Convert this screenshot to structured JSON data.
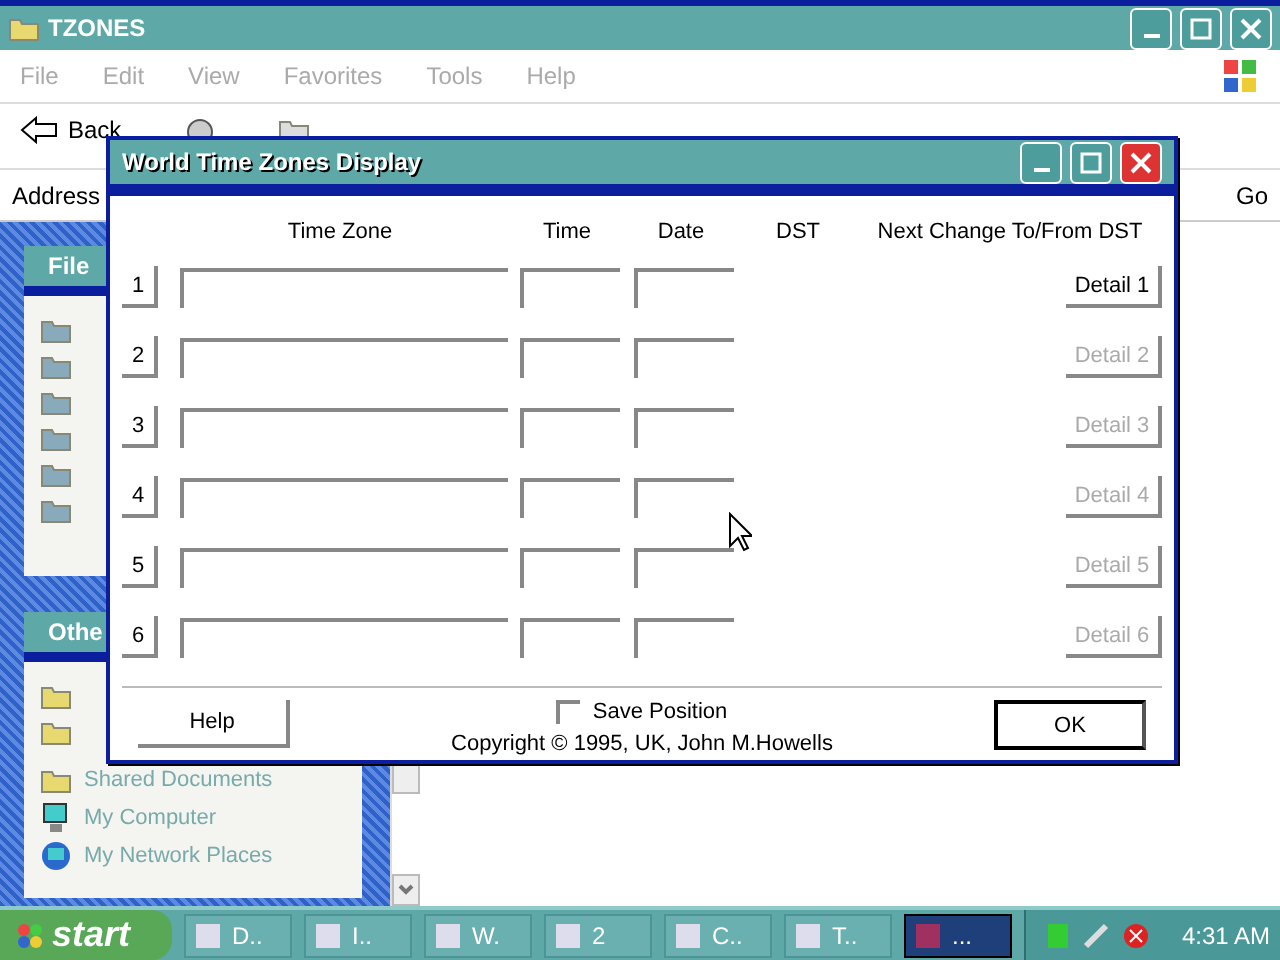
{
  "explorer": {
    "title": "TZONES",
    "menu": [
      "File",
      "Edit",
      "View",
      "Favorites",
      "Tools",
      "Help"
    ],
    "toolbar": [
      {
        "kind": "back",
        "label": "Back"
      },
      {
        "kind": "search"
      },
      {
        "kind": "folders"
      }
    ],
    "address_label": "Address",
    "go_label": "Go",
    "panels": [
      {
        "title": "File"
      },
      {
        "title": "Othe",
        "items": [
          "Shared Documents",
          "My Computer",
          "My Network Places"
        ]
      }
    ]
  },
  "dialog": {
    "title": "World Time Zones Display",
    "columns": [
      "Time Zone",
      "Time",
      "Date",
      "DST",
      "Next Change To/From DST"
    ],
    "rows": [
      {
        "number": "1",
        "detail": "Detail 1",
        "disabled": false
      },
      {
        "number": "2",
        "detail": "Detail 2",
        "disabled": true
      },
      {
        "number": "3",
        "detail": "Detail 3",
        "disabled": true
      },
      {
        "number": "4",
        "detail": "Detail 4",
        "disabled": true
      },
      {
        "number": "5",
        "detail": "Detail 5",
        "disabled": true
      },
      {
        "number": "6",
        "detail": "Detail 6",
        "disabled": true
      }
    ],
    "help_button": "Help",
    "save_position": {
      "label": "Save Position",
      "checked": false
    },
    "copyright": "Copyright © 1995, UK, John M.Howells",
    "ok_button": "OK"
  },
  "taskbar": {
    "start": "start",
    "tasks": [
      {
        "label": "D..",
        "selected": false
      },
      {
        "label": "I..",
        "selected": false
      },
      {
        "label": "W.",
        "selected": false
      },
      {
        "label": "2",
        "selected": false
      },
      {
        "label": "C..",
        "selected": false
      },
      {
        "label": "T..",
        "selected": false
      },
      {
        "label": "...",
        "selected": true
      }
    ],
    "clock": "4:31 AM"
  }
}
